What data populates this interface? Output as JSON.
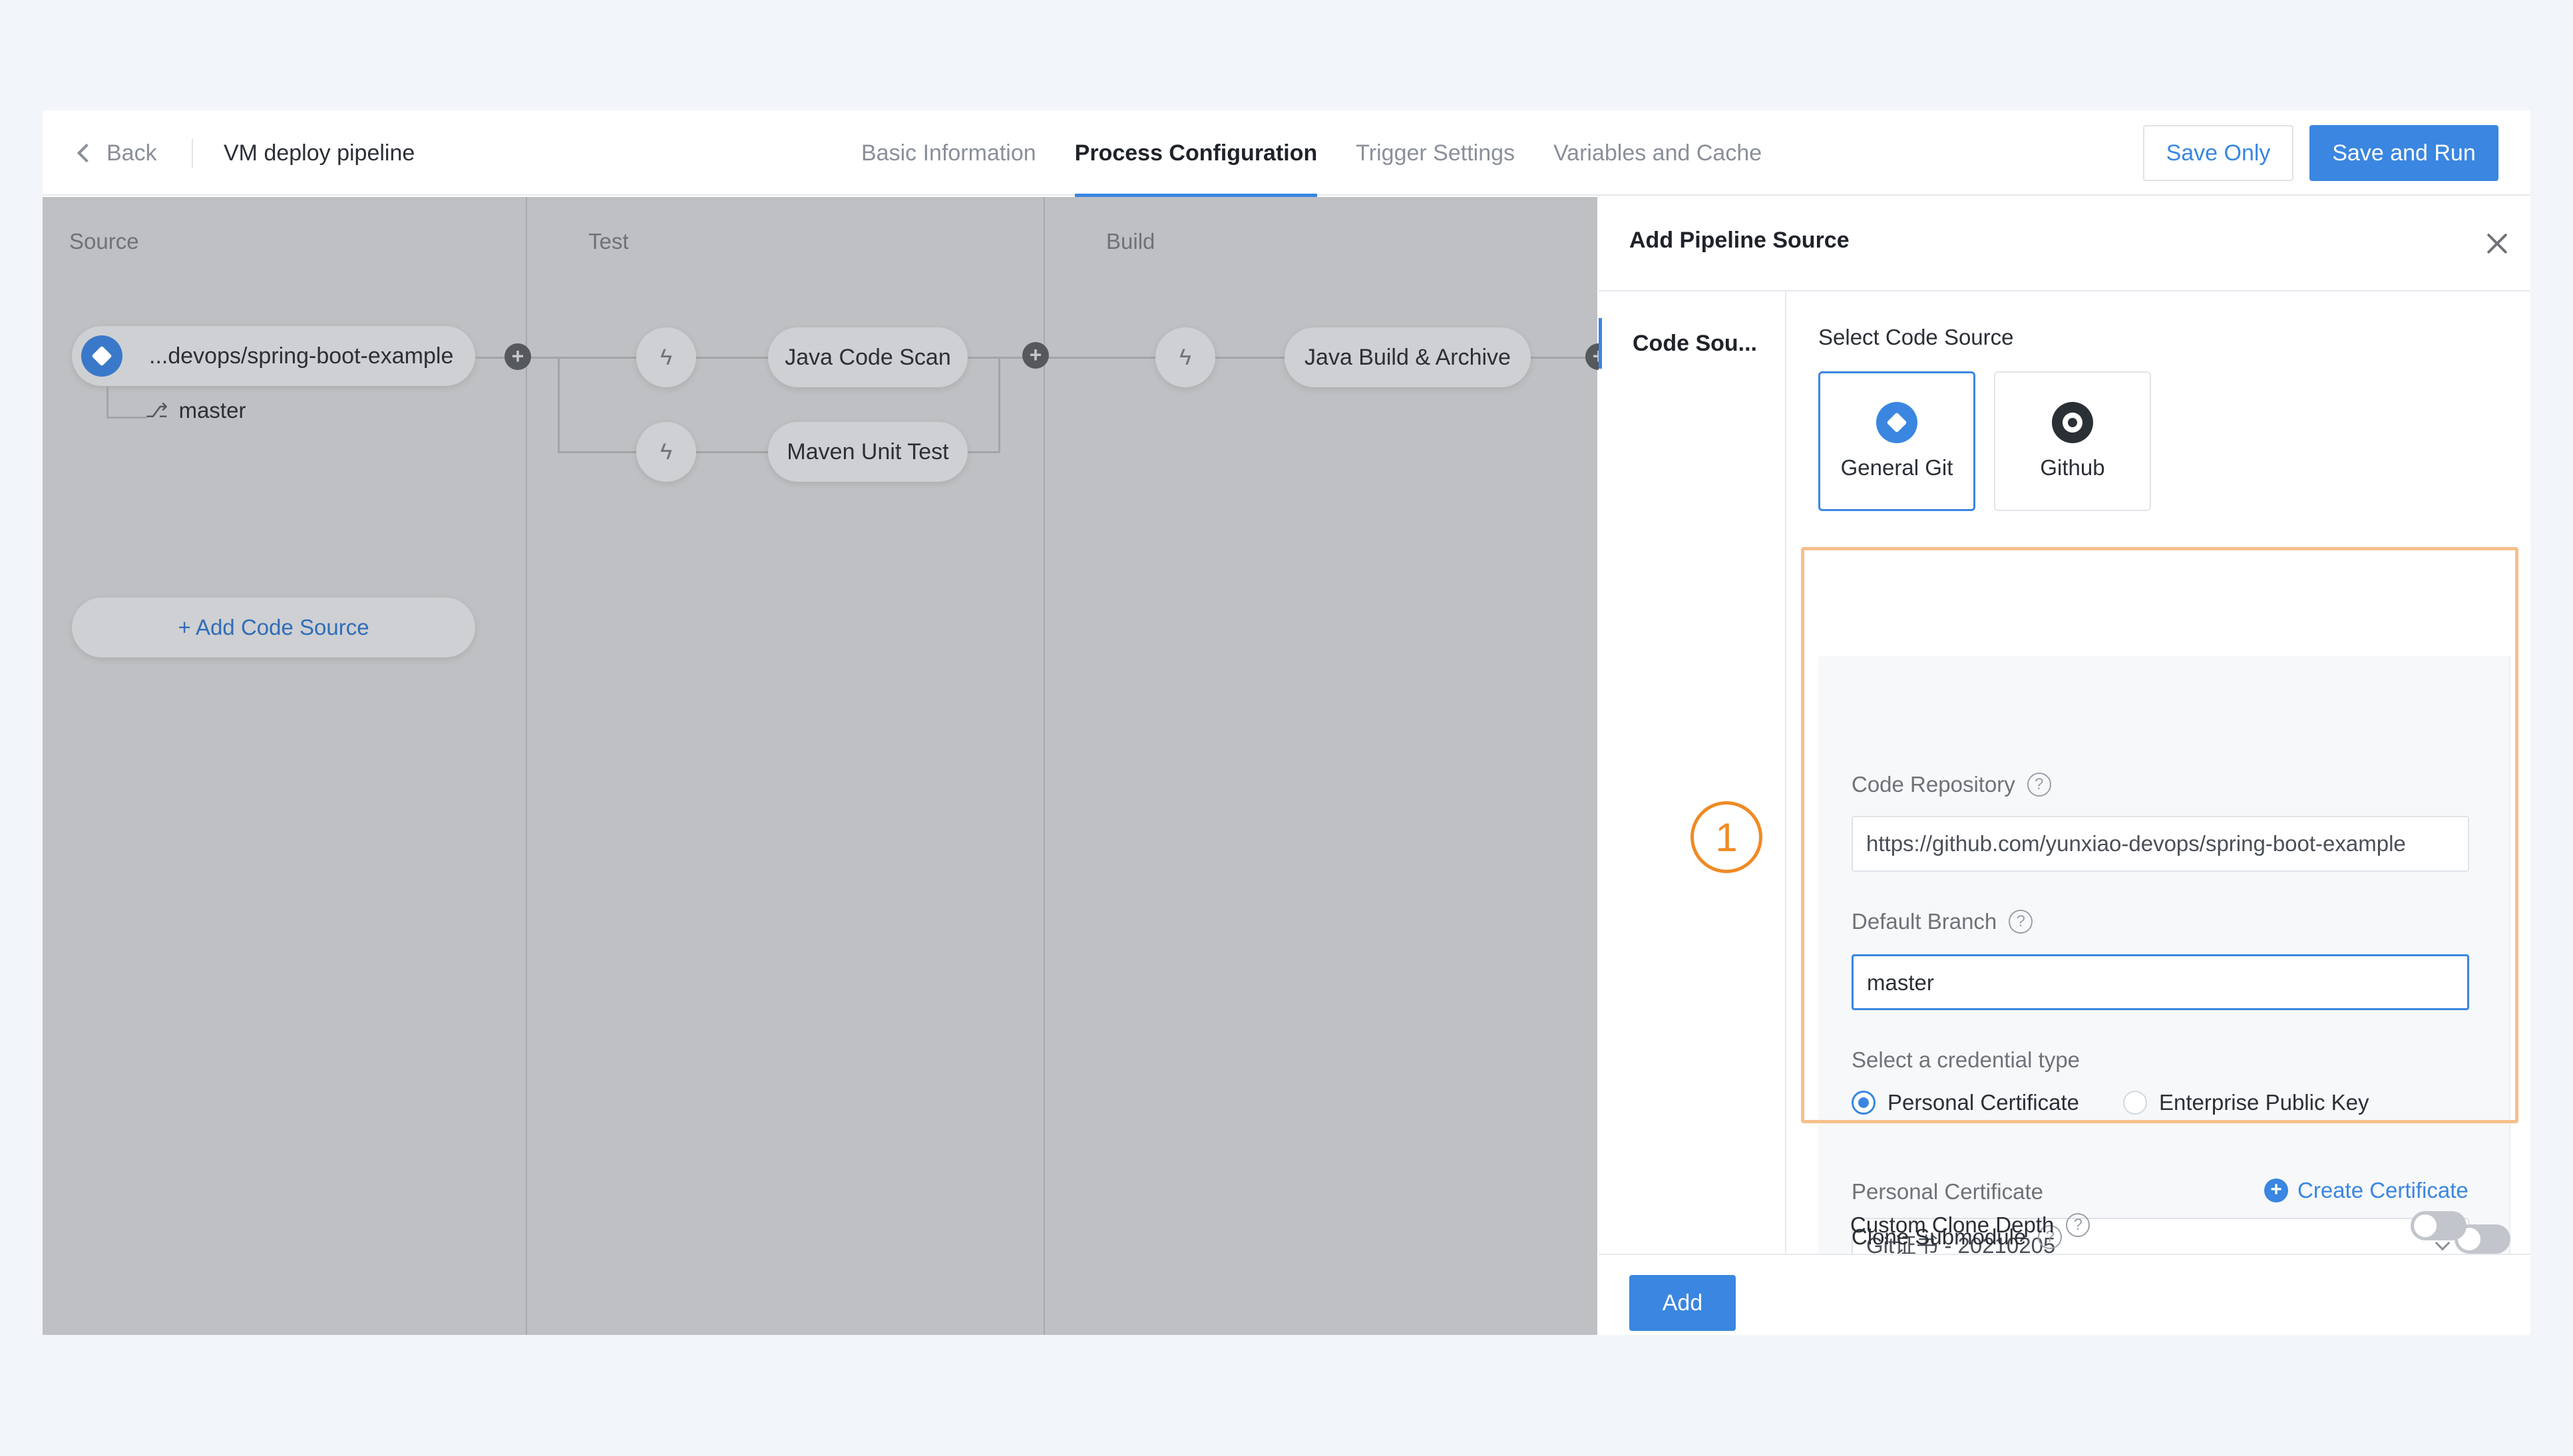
{
  "header": {
    "back_label": "Back",
    "pipeline_name": "VM deploy pipeline",
    "tabs": [
      {
        "label": "Basic Information"
      },
      {
        "label": "Process Configuration"
      },
      {
        "label": "Trigger Settings"
      },
      {
        "label": "Variables and Cache"
      }
    ],
    "active_tab": "Process Configuration",
    "save_only_label": "Save Only",
    "save_run_label": "Save and Run"
  },
  "canvas": {
    "stages": [
      {
        "title": "Source"
      },
      {
        "title": "Test"
      },
      {
        "title": "Build"
      }
    ],
    "source_repo": "...devops/spring-boot-example",
    "source_branch": "master",
    "add_code_source_label": "+ Add Code Source",
    "test_jobs": [
      {
        "label": "Java Code Scan"
      },
      {
        "label": "Maven Unit Test"
      }
    ],
    "build_jobs": [
      {
        "label": "Java Build & Archive"
      }
    ]
  },
  "panel": {
    "title": "Add Pipeline Source",
    "side_nav_item": "Code Sou...",
    "select_code_source_label": "Select Code Source",
    "code_sources": [
      {
        "label": "General Git",
        "selected": true,
        "icon": "git-icon"
      },
      {
        "label": "Github",
        "selected": false,
        "icon": "github-icon"
      }
    ],
    "code_repository_label": "Code Repository",
    "code_repository_value": "https://github.com/yunxiao-devops/spring-boot-example",
    "default_branch_label": "Default Branch",
    "default_branch_value": "master",
    "credential_type_label": "Select a credential type",
    "credential_options": [
      {
        "label": "Personal Certificate",
        "selected": true
      },
      {
        "label": "Enterprise Public Key",
        "selected": false
      }
    ],
    "personal_certificate_label": "Personal Certificate",
    "create_certificate_label": "Create Certificate",
    "certificate_value": "Git证书 - 20210205",
    "clone_submodule_label": "Clone Submodule",
    "custom_clone_depth_label": "Custom Clone Depth",
    "add_button_label": "Add"
  },
  "annotation": {
    "step_number": "1",
    "highlight_color": "#f6c08c",
    "badge_color": "#f08a24"
  },
  "colors": {
    "accent": "#3a86e0",
    "canvas_dim": "#bfc0c3"
  }
}
